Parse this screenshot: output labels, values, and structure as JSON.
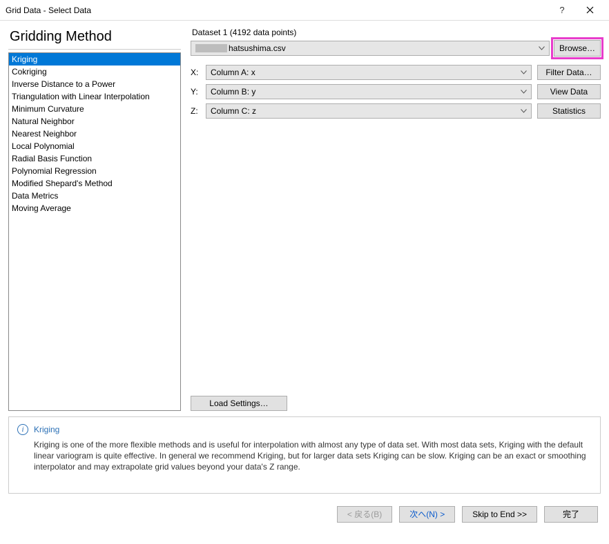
{
  "window": {
    "title": "Grid Data - Select Data",
    "help_symbol": "?"
  },
  "left": {
    "panel_title": "Gridding Method",
    "methods": [
      "Kriging",
      "Cokriging",
      "Inverse Distance to a Power",
      "Triangulation with Linear Interpolation",
      "Minimum Curvature",
      "Natural Neighbor",
      "Nearest Neighbor",
      "Local Polynomial",
      "Radial Basis Function",
      "Polynomial Regression",
      "Modified Shepard's Method",
      "Data Metrics",
      "Moving Average"
    ],
    "selected_index": 0
  },
  "right": {
    "dataset_label": "Dataset 1   (4192 data points)",
    "file_name": "hatsushima.csv",
    "browse_label": "Browse…",
    "rows": [
      {
        "axis": "X:",
        "column": "Column A:  x",
        "button": "Filter Data…"
      },
      {
        "axis": "Y:",
        "column": "Column B:  y",
        "button": "View Data"
      },
      {
        "axis": "Z:",
        "column": "Column C:  z",
        "button": "Statistics"
      }
    ],
    "load_settings_label": "Load Settings…"
  },
  "info": {
    "title": "Kriging",
    "body": "Kriging is one of the more flexible methods and is useful for interpolation with almost any type of data set. With most data sets, Kriging with the default linear variogram is quite effective. In general we recommend Kriging, but for larger data sets Kriging can be slow. Kriging can be an exact or smoothing interpolator and may extrapolate grid values beyond your data's Z range."
  },
  "footer": {
    "back": "< 戻る(B)",
    "next": "次へ(N) >",
    "skip": "Skip to End >>",
    "finish": "完了"
  }
}
